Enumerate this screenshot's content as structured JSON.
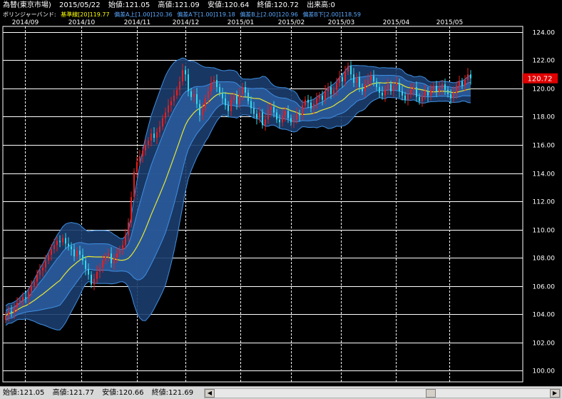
{
  "header": {
    "instrument": "為替(東京市場)",
    "date": "2015/05/22",
    "open_label": "始値:",
    "open": "121.05",
    "high_label": "高値:",
    "high": "121.09",
    "low_label": "安値:",
    "low": "120.64",
    "close_label": "終値:",
    "close": "120.72",
    "volume_label": "出来高:",
    "volume": "0"
  },
  "indicator": {
    "name": "ボリンジャーバンド:",
    "base_label": "基準線[20]",
    "base_value": "119.77",
    "upper1_label": "偏差A上[1.00]",
    "upper1_value": "120.36",
    "lower1_label": "偏差A下[1.00]",
    "lower1_value": "119.18",
    "upper2_label": "偏差B上[2.00]",
    "upper2_value": "120.96",
    "lower2_label": "偏差B下[2.00]",
    "lower2_value": "118.59"
  },
  "price_tag": "120.72",
  "status": {
    "open_label": "始値:",
    "open": "121.05",
    "high_label": "高値:",
    "high": "121.77",
    "low_label": "安値:",
    "low": "120.66",
    "close_label": "終値:",
    "close": "121.69"
  },
  "colors": {
    "background": "#000000",
    "grid": "#ffffff",
    "band_outer": "#1c3d6e",
    "band_inner": "#2a5a9a",
    "band_line": "#3f8fe0",
    "base_line": "#e8e830",
    "candle_up": "#e81e1e",
    "candle_down": "#33d6e8",
    "price_tag": "#e00000",
    "header_base": "#ffff00",
    "header_band": "#5aa8ff"
  },
  "chart_data": {
    "type": "candlestick",
    "x_tick_labels": [
      "2014/09",
      "2014/10",
      "2014/11",
      "2014/12",
      "2015/01",
      "2015/02",
      "2015/03",
      "2015/04",
      "2015/05"
    ],
    "y_tick_labels": [
      "124.00",
      "122.00",
      "120.00",
      "118.00",
      "116.00",
      "114.00",
      "112.00",
      "110.00",
      "108.00",
      "106.00",
      "104.00",
      "102.00",
      "100.00"
    ],
    "ylim": [
      99.2,
      124.4
    ],
    "grid": true,
    "close": [
      103.9,
      104.2,
      104.1,
      104.5,
      104.8,
      105.0,
      105.2,
      105.1,
      105.6,
      106.0,
      106.3,
      106.8,
      107.1,
      107.3,
      107.8,
      108.2,
      108.6,
      108.9,
      109.2,
      109.1,
      109.4,
      109.0,
      108.8,
      108.6,
      108.1,
      108.5,
      108.2,
      107.8,
      107.2,
      106.8,
      106.1,
      106.5,
      107.0,
      107.3,
      107.8,
      108.1,
      108.3,
      107.6,
      108.0,
      108.3,
      108.6,
      108.9,
      109.6,
      110.5,
      112.3,
      114.1,
      114.8,
      115.2,
      115.6,
      116.0,
      116.3,
      116.8,
      116.5,
      116.9,
      117.3,
      117.9,
      118.3,
      118.8,
      119.1,
      119.5,
      119.9,
      120.5,
      121.3,
      121.0,
      119.8,
      119.4,
      119.6,
      118.9,
      118.1,
      118.6,
      119.3,
      119.8,
      120.4,
      120.6,
      120.1,
      119.7,
      119.3,
      118.8,
      118.4,
      119.2,
      119.5,
      118.9,
      119.6,
      120.1,
      119.7,
      119.1,
      118.6,
      118.2,
      117.9,
      118.3,
      117.4,
      117.8,
      118.5,
      118.7,
      118.3,
      117.8,
      117.6,
      118.1,
      118.4,
      117.9,
      117.6,
      117.8,
      118.2,
      118.1,
      118.8,
      119.2,
      119.0,
      118.6,
      118.9,
      119.3,
      119.5,
      119.2,
      119.8,
      120.1,
      119.6,
      119.9,
      120.4,
      120.8,
      120.5,
      121.2,
      121.6,
      121.0,
      120.4,
      120.8,
      120.1,
      119.8,
      120.3,
      120.6,
      120.9,
      120.5,
      120.1,
      119.7,
      119.5,
      119.9,
      120.3,
      119.8,
      120.2,
      120.4,
      119.8,
      119.5,
      119.2,
      119.6,
      119.9,
      120.1,
      119.4,
      119.1,
      119.5,
      119.8,
      119.5,
      119.9,
      120.2,
      119.8,
      120.0,
      120.3,
      119.9,
      119.6,
      119.3,
      119.7,
      120.2,
      120.5,
      120.2,
      120.6,
      121.0,
      120.72
    ]
  }
}
